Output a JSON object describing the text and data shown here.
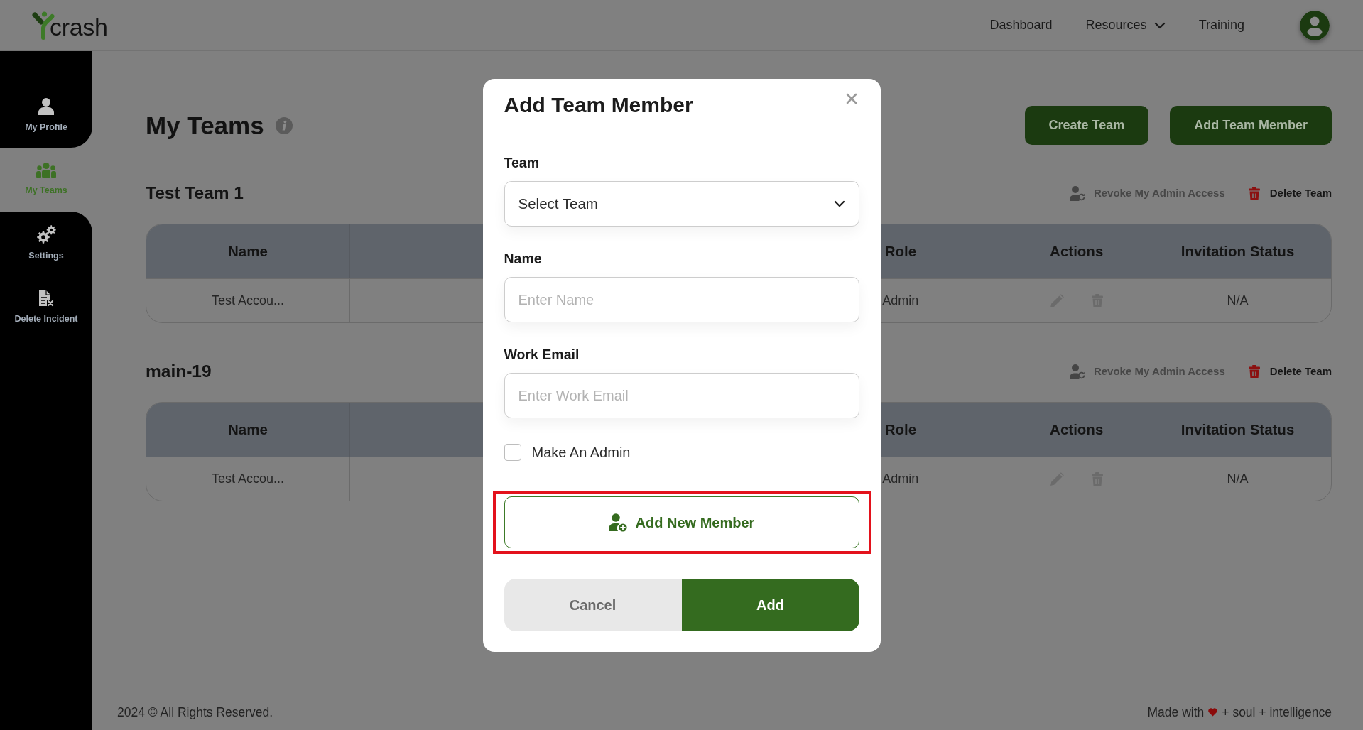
{
  "header": {
    "logo": {
      "text": "crash"
    },
    "nav": [
      {
        "label": "Dashboard",
        "kind": "link"
      },
      {
        "label": "Resources",
        "kind": "dropdown"
      },
      {
        "label": "Training",
        "kind": "link"
      }
    ]
  },
  "sidebar": {
    "items": [
      {
        "label": "My Profile",
        "kind": "profile",
        "selected": false
      },
      {
        "label": "My Teams",
        "kind": "teams",
        "selected": true
      },
      {
        "label": "Settings",
        "kind": "settings",
        "selected": false
      },
      {
        "label": "Delete Incident",
        "kind": "delete_incident",
        "selected": false
      }
    ]
  },
  "page": {
    "title": "My Teams",
    "buttons": [
      {
        "label": "Create Team"
      },
      {
        "label": "Add Team Member"
      }
    ]
  },
  "teams": [
    {
      "name": "Test Team 1",
      "revoke_label": "Revoke My Admin Access",
      "delete_label": "Delete Team",
      "table": {
        "columns": [
          "Name",
          "Role",
          "Actions",
          "Invitation Status"
        ],
        "rows": [
          {
            "name": "Test Accou...",
            "role": "Admin",
            "actions": [
              {
                "kind": "edit"
              },
              {
                "kind": "delete"
              }
            ],
            "invitation_status": "N/A"
          }
        ]
      }
    },
    {
      "name": "main-19",
      "revoke_label": "Revoke My Admin Access",
      "delete_label": "Delete Team",
      "table": {
        "columns": [
          "Name",
          "Role",
          "Actions",
          "Invitation Status"
        ],
        "rows": [
          {
            "name": "Test Accou...",
            "role": "Admin",
            "actions": [
              {
                "kind": "edit"
              },
              {
                "kind": "delete"
              }
            ],
            "invitation_status": "N/A"
          }
        ]
      }
    }
  ],
  "modal": {
    "title": "Add Team Member",
    "fields": [
      {
        "kind": "select",
        "label": "Team",
        "value": "Select Team"
      },
      {
        "kind": "input",
        "label": "Name",
        "placeholder": "Enter Name"
      },
      {
        "kind": "input",
        "label": "Work Email",
        "placeholder": "Enter Work Email"
      }
    ],
    "admin_checkbox": {
      "label": "Make An Admin",
      "checked": false
    },
    "add_new_member": {
      "label": "Add New Member",
      "highlighted": true
    },
    "buttons": [
      {
        "label": "Cancel",
        "kind": "secondary"
      },
      {
        "label": "Add",
        "kind": "primary"
      }
    ]
  },
  "footer": {
    "copyright": "2024 © All Rights Reserved.",
    "credit_before": "Made with",
    "credit_after": "+ soul + intelligence"
  }
}
